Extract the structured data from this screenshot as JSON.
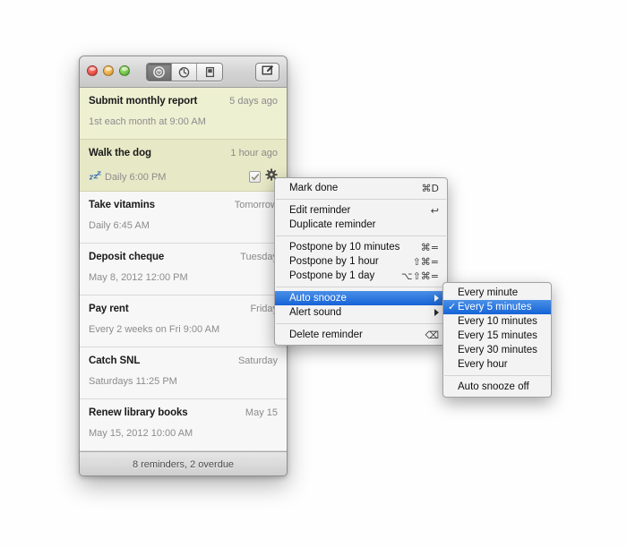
{
  "window": {
    "traffic_lights": [
      "close",
      "minimize",
      "zoom"
    ],
    "toolbar": {
      "segments": [
        {
          "name": "reminders-view",
          "icon": "clock-badge-icon",
          "active": true
        },
        {
          "name": "history-view",
          "icon": "clock-arrow-icon",
          "active": false
        },
        {
          "name": "notes-view",
          "icon": "note-icon",
          "active": false
        }
      ],
      "compose_button": {
        "name": "new-reminder-button",
        "icon": "compose-icon"
      }
    },
    "status_text": "8 reminders, 2 overdue"
  },
  "reminders": [
    {
      "title": "Submit monthly report",
      "when": "5 days ago",
      "schedule": "1st each month at 9:00 AM",
      "overdue": true,
      "selected": false,
      "snoozing": false,
      "show_controls": false
    },
    {
      "title": "Walk the dog",
      "when": "1 hour ago",
      "schedule": "Daily 6:00 PM",
      "overdue": true,
      "selected": true,
      "snoozing": true,
      "show_controls": true
    },
    {
      "title": "Take vitamins",
      "when": "Tomorrow",
      "schedule": "Daily 6:45 AM",
      "overdue": false,
      "selected": false,
      "snoozing": false,
      "show_controls": false
    },
    {
      "title": "Deposit cheque",
      "when": "Tuesday",
      "schedule": "May 8, 2012 12:00 PM",
      "overdue": false,
      "selected": false,
      "snoozing": false,
      "show_controls": false
    },
    {
      "title": "Pay rent",
      "when": "Friday",
      "schedule": "Every 2 weeks on Fri 9:00 AM",
      "overdue": false,
      "selected": false,
      "snoozing": false,
      "show_controls": false
    },
    {
      "title": "Catch SNL",
      "when": "Saturday",
      "schedule": "Saturdays 11:25 PM",
      "overdue": false,
      "selected": false,
      "snoozing": false,
      "show_controls": false
    },
    {
      "title": "Renew library books",
      "when": "May 15",
      "schedule": "May 15, 2012 10:00 AM",
      "overdue": false,
      "selected": false,
      "snoozing": false,
      "show_controls": false
    }
  ],
  "context_menu": {
    "items": [
      {
        "label": "Mark done",
        "shortcut": "⌘D",
        "type": "item"
      },
      {
        "type": "separator"
      },
      {
        "label": "Edit reminder",
        "shortcut": "↩",
        "type": "item"
      },
      {
        "label": "Duplicate reminder",
        "shortcut": "",
        "type": "item"
      },
      {
        "type": "separator"
      },
      {
        "label": "Postpone by 10 minutes",
        "shortcut": "⌘=",
        "type": "item"
      },
      {
        "label": "Postpone by 1 hour",
        "shortcut": "⇧⌘=",
        "type": "item"
      },
      {
        "label": "Postpone by 1 day",
        "shortcut": "⌥⇧⌘=",
        "type": "item"
      },
      {
        "type": "separator"
      },
      {
        "label": "Auto snooze",
        "shortcut": "",
        "type": "submenu",
        "highlighted": true
      },
      {
        "label": "Alert sound",
        "shortcut": "",
        "type": "submenu",
        "highlighted": false
      },
      {
        "type": "separator"
      },
      {
        "label": "Delete reminder",
        "shortcut": "⌫",
        "type": "item"
      }
    ]
  },
  "submenu": {
    "title": "Auto snooze",
    "items": [
      {
        "label": "Every minute",
        "checked": false,
        "highlighted": false,
        "type": "item"
      },
      {
        "label": "Every 5 minutes",
        "checked": true,
        "highlighted": true,
        "type": "item"
      },
      {
        "label": "Every 10 minutes",
        "checked": false,
        "highlighted": false,
        "type": "item"
      },
      {
        "label": "Every 15 minutes",
        "checked": false,
        "highlighted": false,
        "type": "item"
      },
      {
        "label": "Every 30 minutes",
        "checked": false,
        "highlighted": false,
        "type": "item"
      },
      {
        "label": "Every hour",
        "checked": false,
        "highlighted": false,
        "type": "item"
      },
      {
        "type": "separator"
      },
      {
        "label": "Auto snooze off",
        "checked": false,
        "highlighted": false,
        "type": "item"
      }
    ]
  },
  "colors": {
    "overdue_row": "#eef0d2",
    "overdue_row_selected": "#e7e9c6",
    "menu_highlight": "#1563d6",
    "snooze_icon": "#3a6fb0"
  }
}
